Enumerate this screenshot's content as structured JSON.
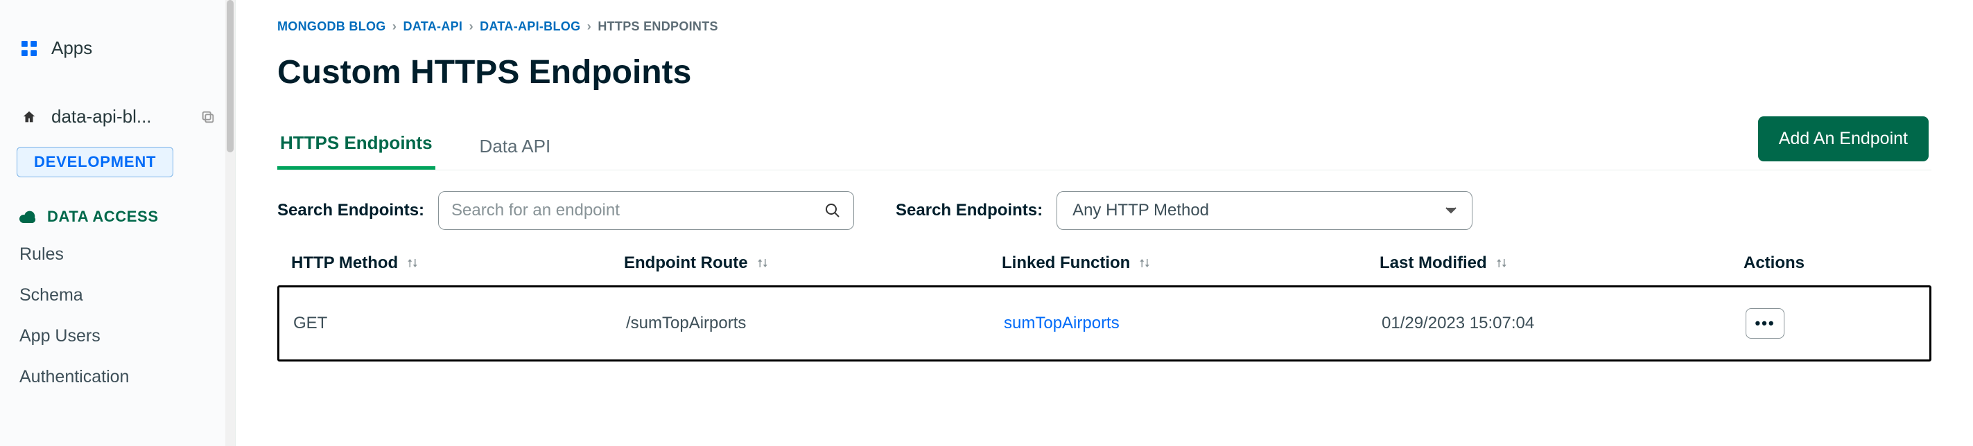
{
  "sidebar": {
    "apps_label": "Apps",
    "app_name": "data-api-bl...",
    "dev_badge": "DEVELOPMENT",
    "section_label": "DATA ACCESS",
    "nav": [
      "Rules",
      "Schema",
      "App Users",
      "Authentication"
    ]
  },
  "breadcrumbs": {
    "items": [
      "MONGODB BLOG",
      "DATA-API",
      "DATA-API-BLOG",
      "HTTPS ENDPOINTS"
    ],
    "sep": "›"
  },
  "page_title": "Custom HTTPS Endpoints",
  "tabs": {
    "items": [
      "HTTPS Endpoints",
      "Data API"
    ],
    "active_index": 0
  },
  "add_button_label": "Add An Endpoint",
  "search": {
    "label": "Search Endpoints:",
    "placeholder": "Search for an endpoint",
    "filter_label": "Search Endpoints:",
    "http_method_selected": "Any HTTP Method"
  },
  "table": {
    "headers": [
      "HTTP Method",
      "Endpoint Route",
      "Linked Function",
      "Last Modified",
      "Actions"
    ],
    "rows": [
      {
        "method": "GET",
        "route": "/sumTopAirports",
        "function": "sumTopAirports",
        "modified": "01/29/2023 15:07:04"
      }
    ]
  }
}
